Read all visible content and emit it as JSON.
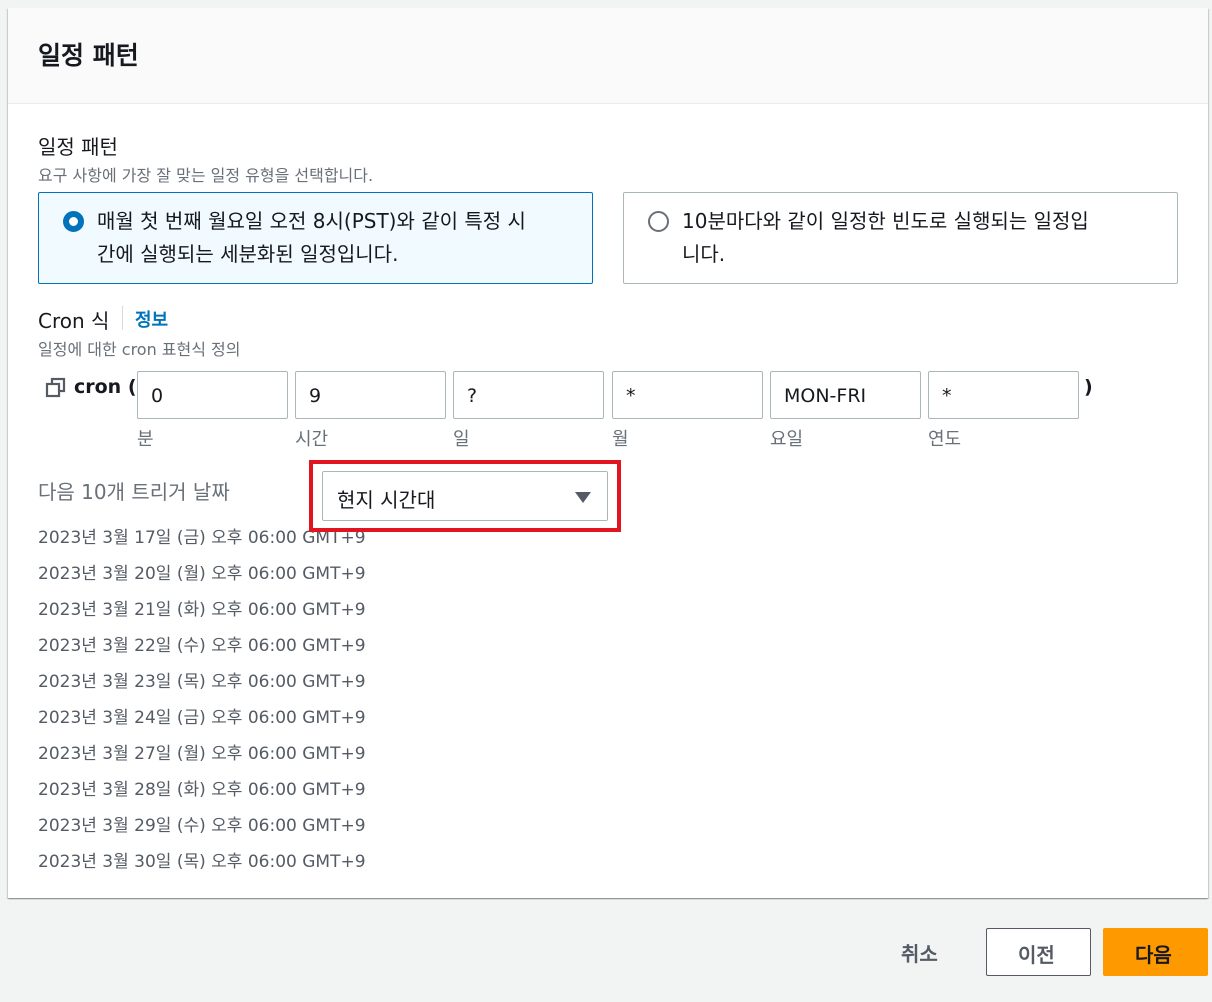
{
  "header": {
    "title": "일정 패턴"
  },
  "pattern": {
    "label": "일정 패턴",
    "description": "요구 사항에 가장 잘 맞는 일정 유형을 선택합니다.",
    "options": [
      {
        "line1": "매월 첫 번째 월요일 오전 8시(PST)와 같이 특정 시",
        "line2": "간에 실행되는 세분화된 일정입니다.",
        "selected": true
      },
      {
        "line1": "10분마다와 같이 일정한 빈도로 실행되는 일정입",
        "line2": "니다.",
        "selected": false
      }
    ]
  },
  "cron": {
    "label": "Cron 식",
    "info_link": "정보",
    "description": "일정에 대한 cron 표현식 정의",
    "prefix": "cron (",
    "suffix": ")",
    "fields": [
      {
        "value": "0",
        "sublabel": "분"
      },
      {
        "value": "9",
        "sublabel": "시간"
      },
      {
        "value": "?",
        "sublabel": "일"
      },
      {
        "value": "*",
        "sublabel": "월"
      },
      {
        "value": "MON-FRI",
        "sublabel": "요일"
      },
      {
        "value": "*",
        "sublabel": "연도"
      }
    ]
  },
  "triggers": {
    "label": "다음 10개 트리거 날짜",
    "timezone_select": "현지 시간대",
    "dates": [
      "2023년 3월 17일 (금) 오후 06:00 GMT+9",
      "2023년 3월 20일 (월) 오후 06:00 GMT+9",
      "2023년 3월 21일 (화) 오후 06:00 GMT+9",
      "2023년 3월 22일 (수) 오후 06:00 GMT+9",
      "2023년 3월 23일 (목) 오후 06:00 GMT+9",
      "2023년 3월 24일 (금) 오후 06:00 GMT+9",
      "2023년 3월 27일 (월) 오후 06:00 GMT+9",
      "2023년 3월 28일 (화) 오후 06:00 GMT+9",
      "2023년 3월 29일 (수) 오후 06:00 GMT+9",
      "2023년 3월 30일 (목) 오후 06:00 GMT+9"
    ]
  },
  "footer": {
    "cancel_label": "취소",
    "previous_label": "이전",
    "next_label": "다음"
  },
  "colors": {
    "accent_blue": "#0073bb",
    "primary_button": "#ff9900",
    "highlight_box": "#e0151f"
  }
}
